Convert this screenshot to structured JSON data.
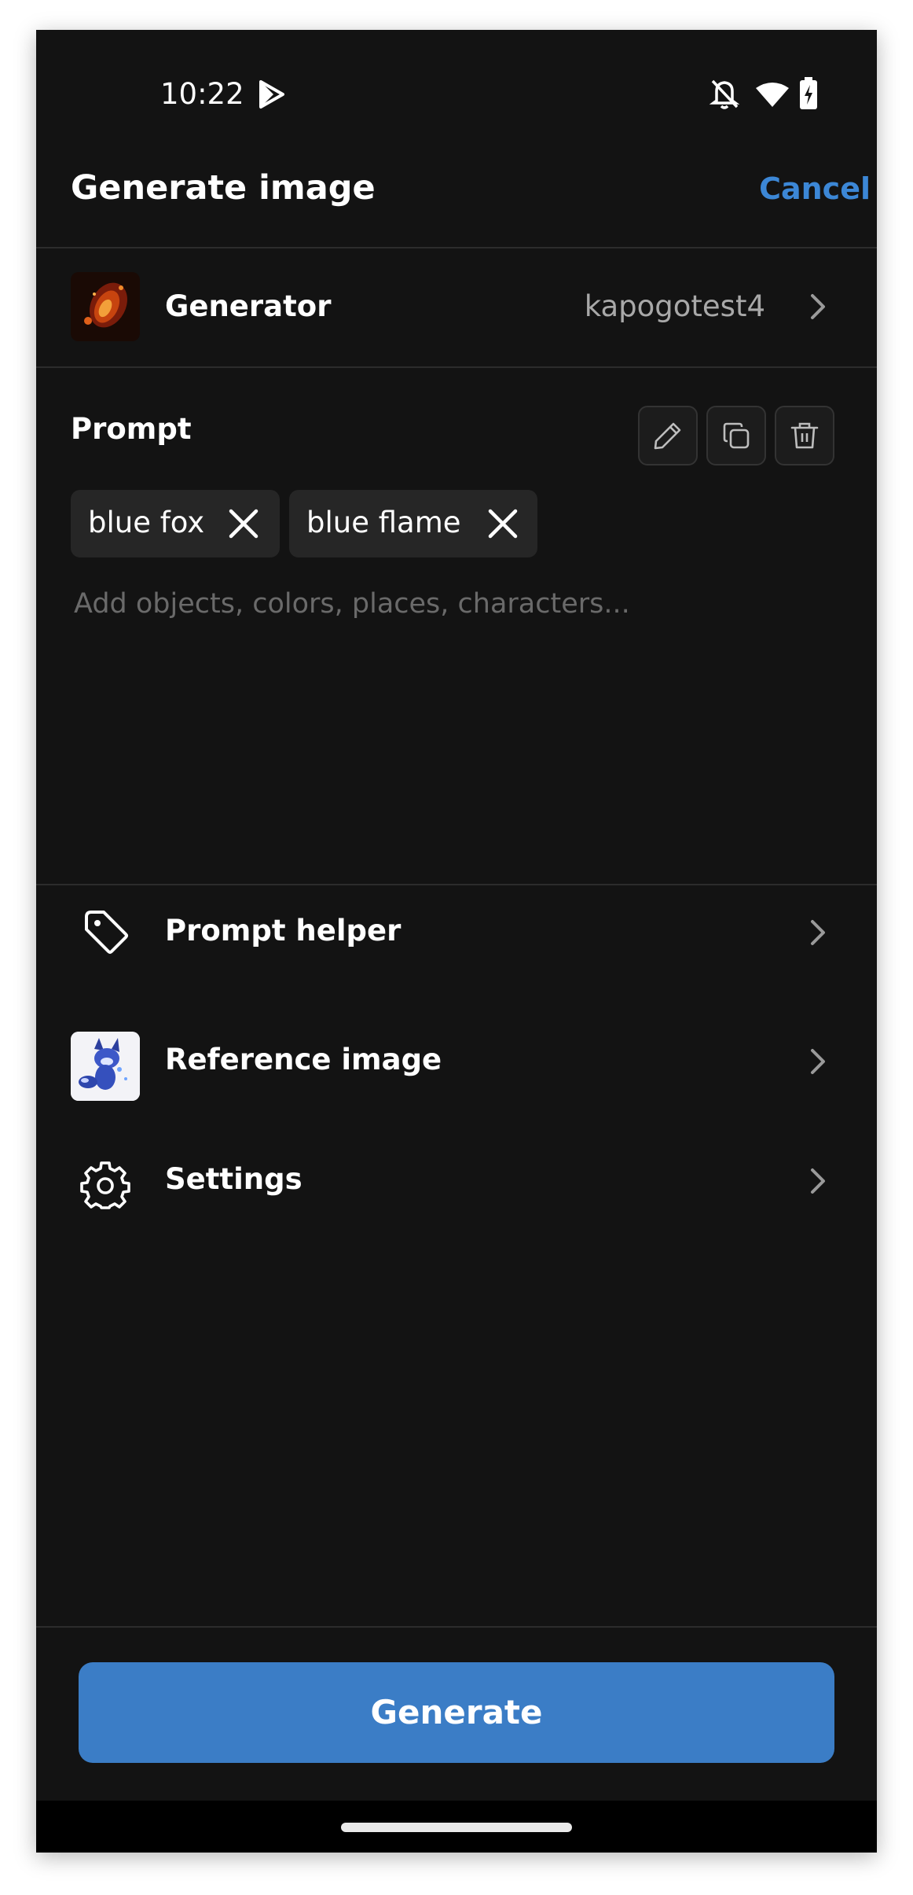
{
  "status_bar": {
    "time": "10:22",
    "icons": [
      "play-store-icon",
      "bell-off-icon",
      "wifi-icon",
      "battery-charging-icon"
    ]
  },
  "header": {
    "title": "Generate image",
    "cancel_label": "Cancel"
  },
  "generator": {
    "label": "Generator",
    "value": "kapogotest4"
  },
  "prompt": {
    "label": "Prompt",
    "tools": [
      "edit-icon",
      "copy-icon",
      "trash-icon"
    ],
    "chips": [
      "blue fox",
      "blue flame"
    ],
    "placeholder": "Add objects, colors, places, characters..."
  },
  "menu": {
    "prompt_helper": "Prompt helper",
    "reference_image": "Reference image",
    "settings": "Settings"
  },
  "footer": {
    "generate_label": "Generate"
  },
  "colors": {
    "background": "#131313",
    "accent": "#3b7dc6",
    "cancel": "#3c87d6",
    "divider": "#2c2c2c",
    "chip": "#262626"
  }
}
